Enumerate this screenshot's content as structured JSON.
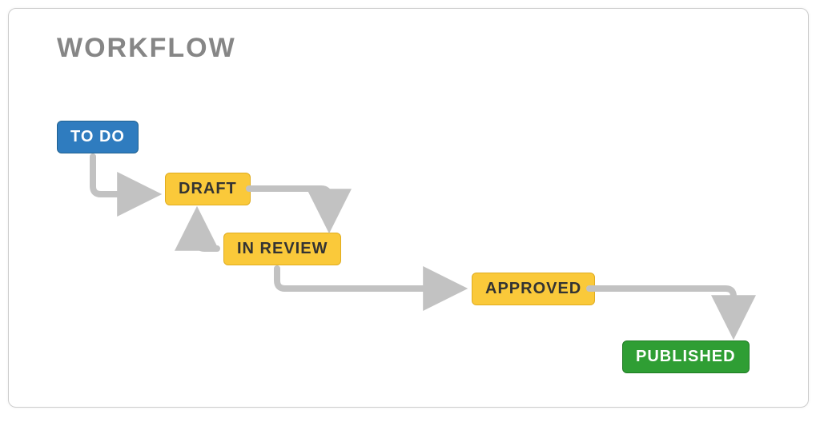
{
  "title": "WORKFLOW",
  "nodes": {
    "todo": {
      "label": "TO DO",
      "color": "blue"
    },
    "draft": {
      "label": "DRAFT",
      "color": "yellow"
    },
    "in_review": {
      "label": "IN REVIEW",
      "color": "yellow"
    },
    "approved": {
      "label": "APPROVED",
      "color": "yellow"
    },
    "published": {
      "label": "PUBLISHED",
      "color": "green"
    }
  },
  "transitions": [
    {
      "from": "todo",
      "to": "draft"
    },
    {
      "from": "draft",
      "to": "in_review"
    },
    {
      "from": "in_review",
      "to": "draft"
    },
    {
      "from": "in_review",
      "to": "approved"
    },
    {
      "from": "approved",
      "to": "published"
    }
  ],
  "colors": {
    "arrow": "#c2c2c2"
  }
}
